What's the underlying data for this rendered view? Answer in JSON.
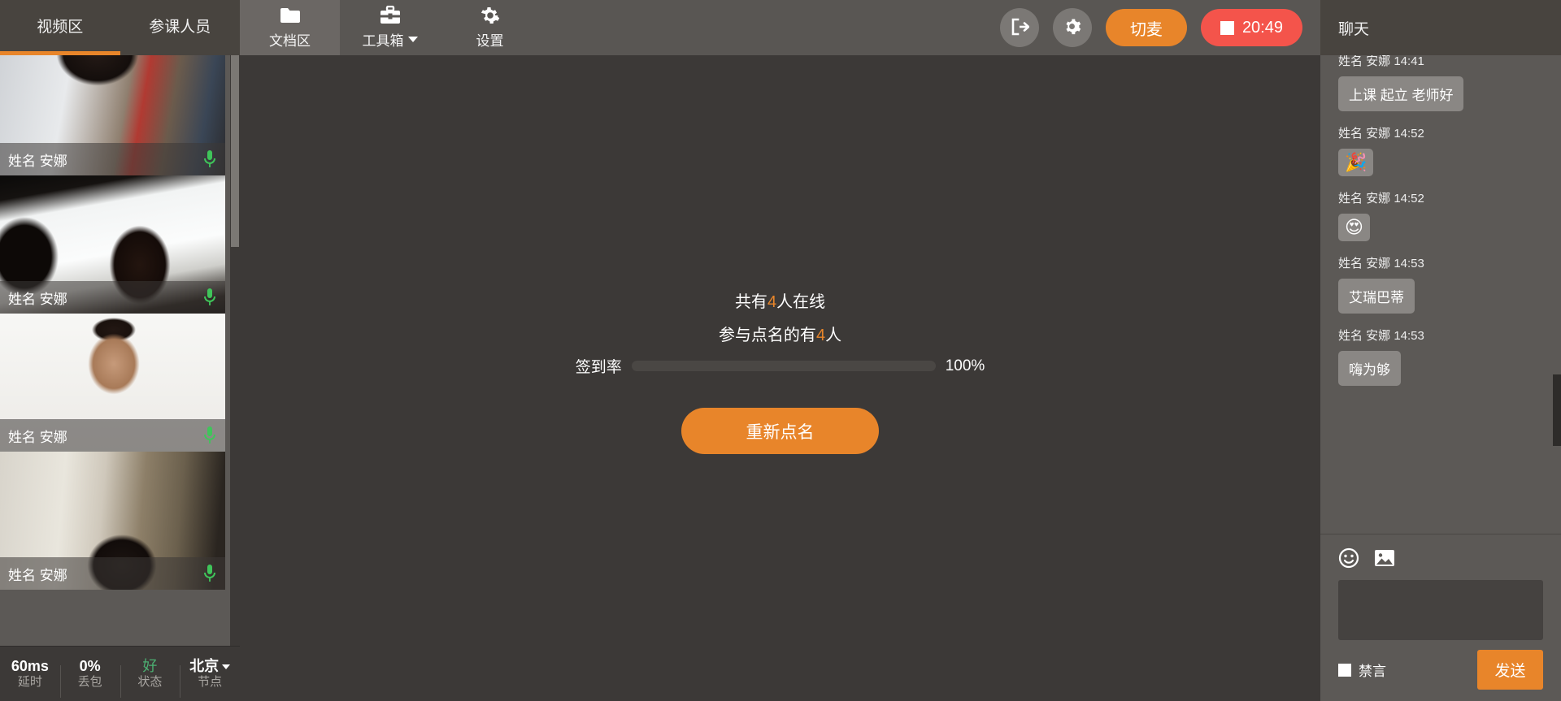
{
  "left_panel": {
    "tabs": [
      {
        "label": "视频区",
        "active": true
      },
      {
        "label": "参课人员",
        "active": false
      }
    ],
    "video_tiles": [
      {
        "name": "姓名 安娜",
        "mic": "mic-on-icon"
      },
      {
        "name": "姓名 安娜",
        "mic": "mic-on-icon"
      },
      {
        "name": "姓名 安娜",
        "mic": "mic-on-icon"
      },
      {
        "name": "姓名 安娜",
        "mic": "mic-on-icon"
      }
    ],
    "status_bar": [
      {
        "value": "60ms",
        "label": "延时",
        "state": "normal"
      },
      {
        "value": "0%",
        "label": "丢包",
        "state": "normal"
      },
      {
        "value": "好",
        "label": "状态",
        "state": "good"
      },
      {
        "value": "北京",
        "label": "节点",
        "state": "dropdown"
      }
    ]
  },
  "header": {
    "nav": [
      {
        "label": "文档区",
        "icon": "folder-icon",
        "active": true,
        "has_caret": false
      },
      {
        "label": "工具箱",
        "icon": "toolbox-icon",
        "active": false,
        "has_caret": true
      },
      {
        "label": "设置",
        "icon": "gear-icon",
        "active": false,
        "has_caret": false
      }
    ],
    "exit_icon": "exit-icon",
    "settings_icon": "gear-icon",
    "mic_toggle_label": "切麦",
    "timer_label": "20:49"
  },
  "main": {
    "rollcall": {
      "online_prefix": "共有",
      "online_count": "4",
      "online_suffix": "人在线",
      "participated_prefix": "参与点名的有",
      "participated_count": "4",
      "participated_suffix": "人",
      "rate_label": "签到率",
      "rate_percent": "100%",
      "rate_value": 100,
      "button_label": "重新点名"
    }
  },
  "chat": {
    "title": "聊天",
    "messages": [
      {
        "meta": "姓名 安娜 14:41",
        "text": "上课 起立 老师好",
        "type": "text",
        "clipped": true
      },
      {
        "meta": "姓名 安娜 14:52",
        "text": "🎉",
        "type": "emoji",
        "clipped": false
      },
      {
        "meta": "姓名 安娜 14:52",
        "text": "😍",
        "type": "emoji",
        "clipped": false
      },
      {
        "meta": "姓名 安娜 14:53",
        "text": "艾瑞巴蒂",
        "type": "text",
        "clipped": false
      },
      {
        "meta": "姓名 安娜 14:53",
        "text": "嗨为够",
        "type": "text",
        "clipped": false
      }
    ],
    "emoji_icon": "smiley-icon",
    "image_icon": "image-icon",
    "input_value": "",
    "input_placeholder": "",
    "mute_all_label": "禁言",
    "mute_all_checked": false,
    "send_label": "发送"
  },
  "colors": {
    "accent_orange": "#e8852a",
    "record_red": "#f4544b",
    "status_good_green": "#4caf72",
    "mic_green": "#3fc55a",
    "header_bg": "#595653",
    "main_bg": "#3c3937",
    "chat_bg": "#5c5956",
    "bubble_bg": "#8a8784"
  }
}
